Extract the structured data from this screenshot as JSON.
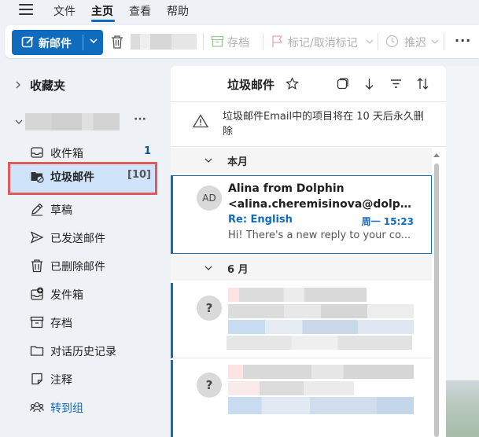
{
  "menu": {
    "items": [
      "文件",
      "主页",
      "查看",
      "帮助"
    ],
    "active": "主页"
  },
  "toolbar": {
    "new_mail_label": "新邮件",
    "archive_label": "存档",
    "flag_label": "标记/取消标记",
    "snooze_label": "推迟",
    "more_label": "···"
  },
  "sidebar": {
    "favorites_label": "收藏夹",
    "account_more": "···",
    "folders": [
      {
        "label": "收件箱",
        "count": "1",
        "icon": "inbox-icon"
      },
      {
        "label": "垃圾邮件",
        "count": "[10]",
        "icon": "junk-folder-icon"
      },
      {
        "label": "草稿",
        "count": "",
        "icon": "draft-pencil-icon"
      },
      {
        "label": "已发送邮件",
        "count": "",
        "icon": "send-icon"
      },
      {
        "label": "已删除邮件",
        "count": "",
        "icon": "trash-icon"
      },
      {
        "label": "发件箱",
        "count": "",
        "icon": "outbox-icon"
      },
      {
        "label": "存档",
        "count": "",
        "icon": "archive-icon"
      },
      {
        "label": "对话历史记录",
        "count": "",
        "icon": "folder-icon"
      },
      {
        "label": "注释",
        "count": "",
        "icon": "note-icon"
      },
      {
        "label": "转到组",
        "count": "",
        "icon": "people-icon"
      }
    ]
  },
  "list": {
    "title": "垃圾邮件",
    "notice": "垃圾邮件Email中的项目将在 10 天后永久删除",
    "groups": [
      "本月",
      "6 月"
    ],
    "selected_mail": {
      "initials": "AD",
      "sender": "Alina from Dolphin",
      "sender_email": "<alina.cheremisinova@dolphin...",
      "subject": "Re: English",
      "time": "周一 15:23",
      "preview": "Hi! There's a new reply to your co..."
    },
    "unknown_avatar": "?"
  },
  "colors": {
    "accent": "#0f6cbd",
    "selected_folder_bg": "#cfe4fa",
    "highlight_border": "#e05a5a"
  }
}
